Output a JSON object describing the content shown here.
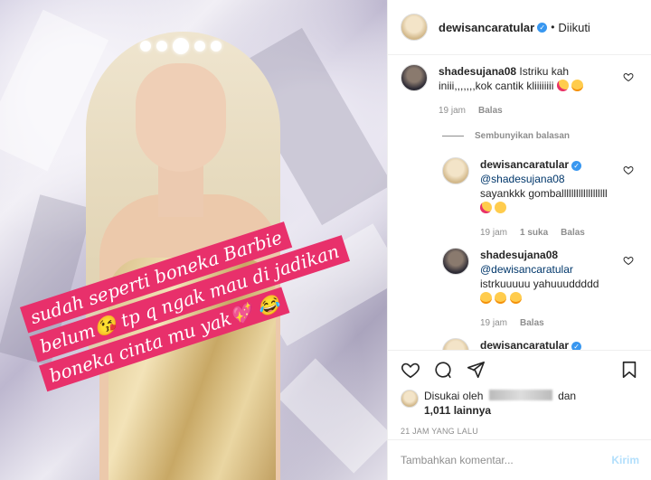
{
  "media": {
    "caption_lines": [
      "sudah seperti boneka Barbie",
      "belum😘 tp q ngak mau di jadikan",
      "boneka cinta mu yak💖 😂"
    ]
  },
  "header": {
    "username": "dewisancaratular",
    "separator": "•",
    "follow_status": "Diikuti"
  },
  "comments": [
    {
      "username": "shadesujana08",
      "text": "Istriku kah iniii,,,,,,,kok cantik kliiiiiiii",
      "time": "19 jam",
      "reply_label": "Balas"
    }
  ],
  "hide_replies_label": "Sembunyikan balasan",
  "replies": [
    {
      "username": "dewisancaratular",
      "mention": "@shadesujana08",
      "text": "sayankkk gomballlllllllllllllllll",
      "time": "19 jam",
      "likes": "1 suka",
      "reply_label": "Balas"
    },
    {
      "username": "shadesujana08",
      "mention": "@dewisancaratular",
      "text": "istrkuuuuu yahuuuddddd",
      "time": "19 jam",
      "reply_label": "Balas"
    },
    {
      "username": "dewisancaratular"
    }
  ],
  "likes": {
    "prefix": "Disukai oleh",
    "and": "dan",
    "count": "1,011 lainnya"
  },
  "timestamp": "21 JAM YANG LALU",
  "add_comment": {
    "placeholder": "Tambahkan komentar...",
    "post_label": "Kirim"
  },
  "colors": {
    "verified": "#3897f0",
    "caption_bg": "#e8306b",
    "post_button": "#b2dffc"
  }
}
